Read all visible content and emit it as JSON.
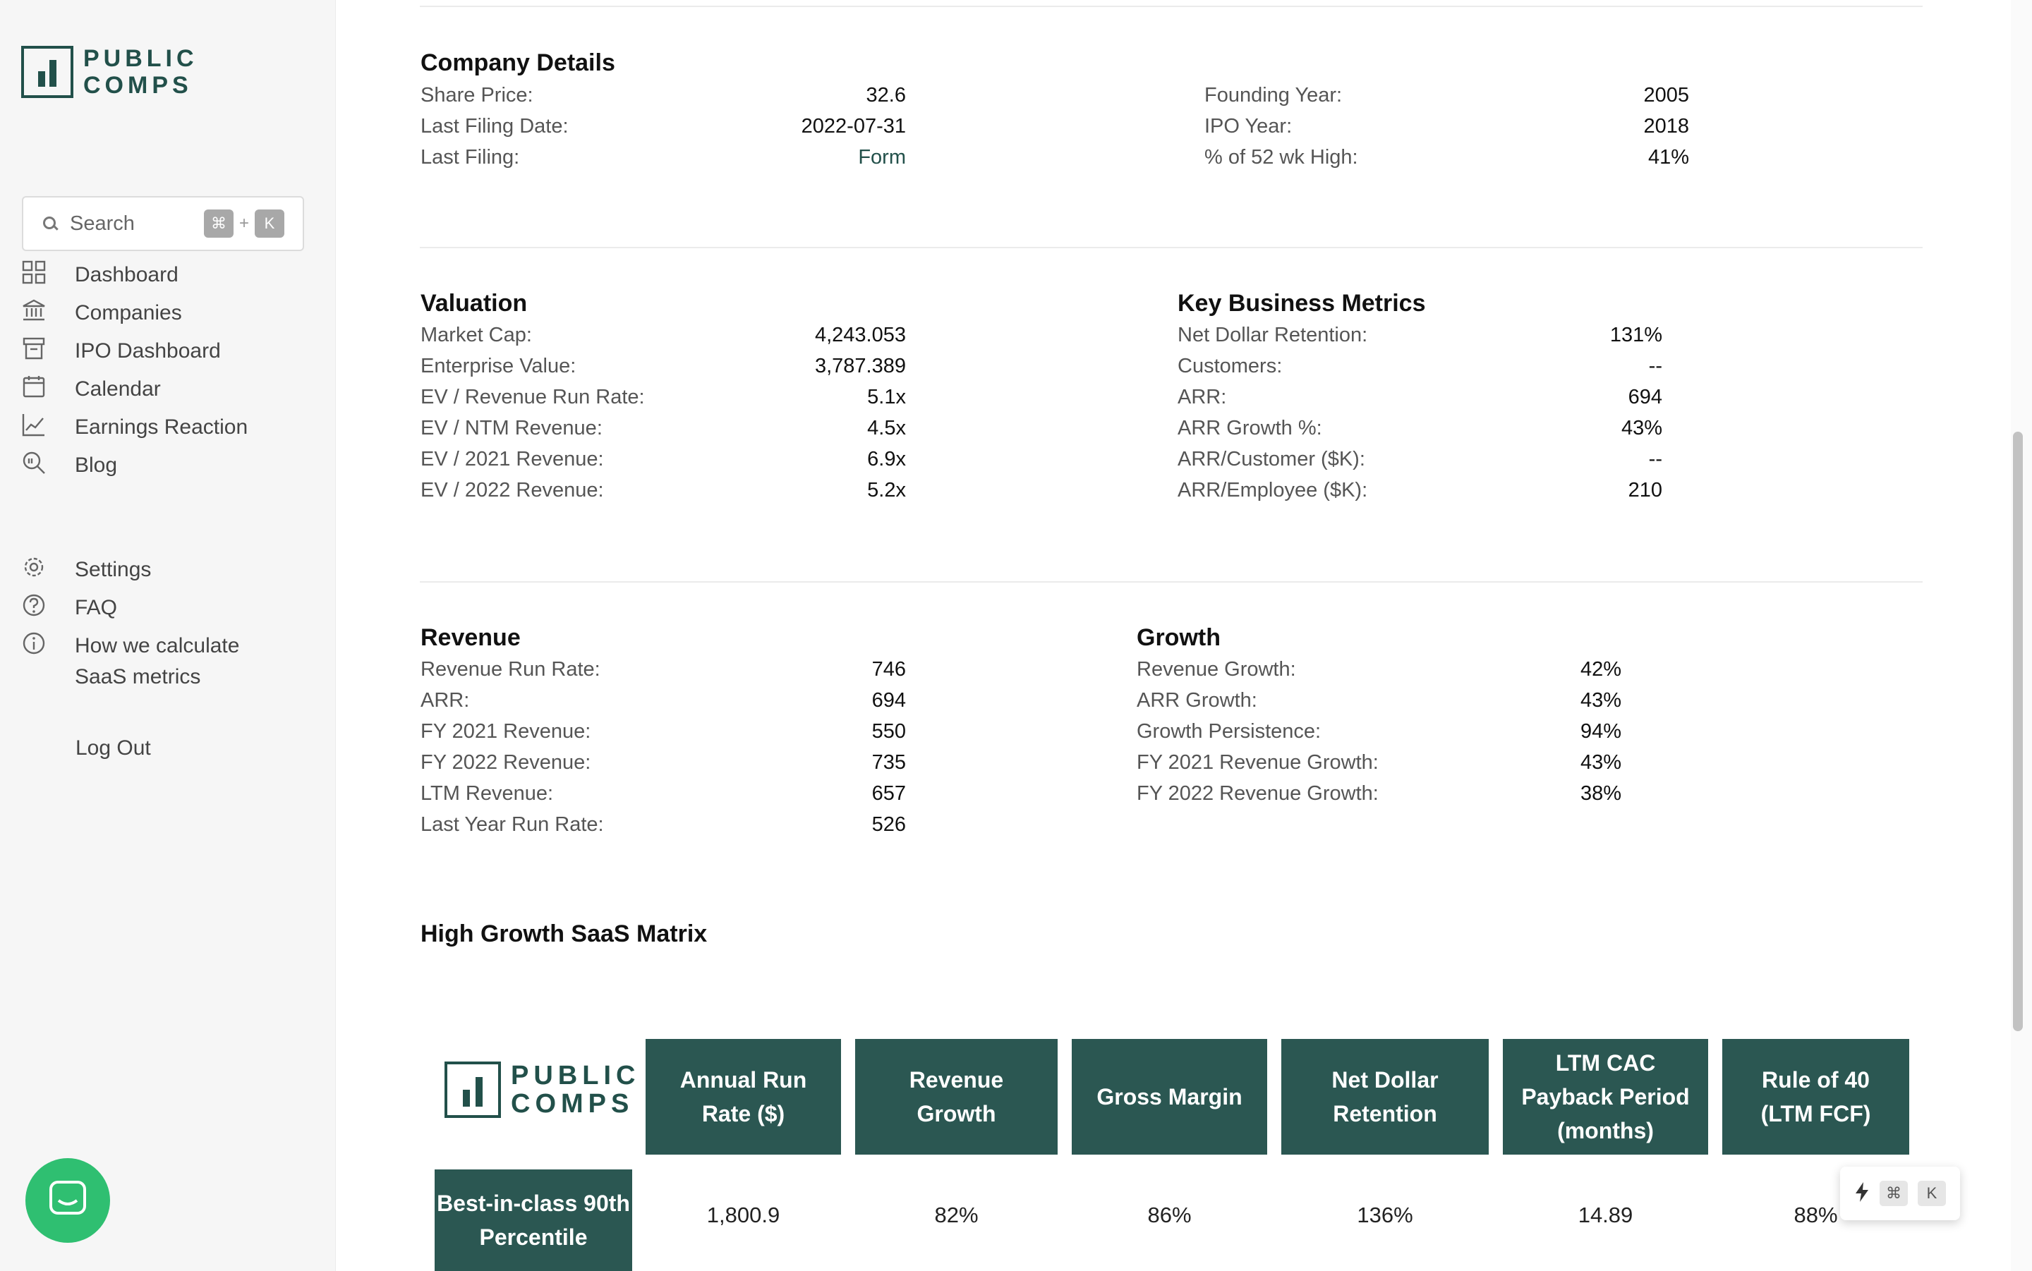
{
  "sidebar": {
    "logo": {
      "line1": "PUBLIC",
      "line2": "COMPS"
    },
    "search": {
      "placeholder": "Search",
      "shortcut_mod": "⌘",
      "shortcut_plus": "+",
      "shortcut_key": "K"
    },
    "nav": [
      {
        "label": "Dashboard",
        "icon": "grid-icon"
      },
      {
        "label": "Companies",
        "icon": "bank-icon"
      },
      {
        "label": "IPO Dashboard",
        "icon": "inbox-icon"
      },
      {
        "label": "Calendar",
        "icon": "calendar-icon"
      },
      {
        "label": "Earnings Reaction",
        "icon": "chart-line-icon"
      },
      {
        "label": "Blog",
        "icon": "search-document-icon"
      }
    ],
    "secondary": [
      {
        "label": "Settings",
        "icon": "gear-icon"
      },
      {
        "label": "FAQ",
        "icon": "question-icon"
      },
      {
        "label": "How we calculate",
        "label2": "SaaS metrics",
        "icon": "info-icon"
      }
    ],
    "logout": "Log Out"
  },
  "company_details": {
    "title": "Company Details",
    "left": [
      {
        "label": "Share Price:",
        "value": "32.6"
      },
      {
        "label": "Last Filing Date:",
        "value": "2022-07-31"
      },
      {
        "label": "Last Filing:",
        "value": "Form"
      }
    ],
    "right": [
      {
        "label": "Founding Year:",
        "value": "2005"
      },
      {
        "label": "IPO Year:",
        "value": "2018"
      },
      {
        "label": "% of 52 wk High:",
        "value": "41%"
      }
    ]
  },
  "valuation": {
    "title": "Valuation",
    "rows": [
      {
        "label": "Market Cap:",
        "value": "4,243.053"
      },
      {
        "label": "Enterprise Value:",
        "value": "3,787.389"
      },
      {
        "label": "EV / Revenue Run Rate:",
        "value": "5.1x"
      },
      {
        "label": "EV / NTM Revenue:",
        "value": "4.5x"
      },
      {
        "label": "EV / 2021 Revenue:",
        "value": "6.9x"
      },
      {
        "label": "EV / 2022 Revenue:",
        "value": "5.2x"
      }
    ]
  },
  "key_metrics": {
    "title": "Key Business Metrics",
    "rows": [
      {
        "label": "Net Dollar Retention:",
        "value": "131%"
      },
      {
        "label": "Customers:",
        "value": "--"
      },
      {
        "label": "ARR:",
        "value": "694"
      },
      {
        "label": "ARR Growth %:",
        "value": "43%"
      },
      {
        "label": "ARR/Customer ($K):",
        "value": "--"
      },
      {
        "label": "ARR/Employee ($K):",
        "value": "210"
      }
    ]
  },
  "revenue": {
    "title": "Revenue",
    "rows": [
      {
        "label": "Revenue Run Rate:",
        "value": "746"
      },
      {
        "label": "ARR:",
        "value": "694"
      },
      {
        "label": "FY 2021 Revenue:",
        "value": "550"
      },
      {
        "label": "FY 2022 Revenue:",
        "value": "735"
      },
      {
        "label": "LTM Revenue:",
        "value": "657"
      },
      {
        "label": "Last Year Run Rate:",
        "value": "526"
      }
    ]
  },
  "growth": {
    "title": "Growth",
    "rows": [
      {
        "label": "Revenue Growth:",
        "value": "42%"
      },
      {
        "label": "ARR Growth:",
        "value": "43%"
      },
      {
        "label": "Growth Persistence:",
        "value": "94%"
      },
      {
        "label": "FY 2021 Revenue Growth:",
        "value": "43%"
      },
      {
        "label": "FY 2022 Revenue Growth:",
        "value": "38%"
      }
    ]
  },
  "matrix": {
    "title": "High Growth SaaS Matrix",
    "logo": {
      "line1": "PUBLIC",
      "line2": "COMPS"
    },
    "headers": [
      "Annual Run Rate ($)",
      "Revenue Growth",
      "Gross Margin",
      "Net Dollar Retention",
      "LTM CAC Payback Period (months)",
      "Rule of 40 (LTM FCF)"
    ],
    "row_label": "Best-in-class 90th Percentile",
    "row_values": [
      "1,800.9",
      "82%",
      "86%",
      "136%",
      "14.89",
      "88%"
    ]
  },
  "shortcut_widget": {
    "icon": "bolt-icon",
    "mod": "⌘",
    "key": "K"
  },
  "colors": {
    "brand": "#22504a",
    "header_fill": "#2b5752",
    "chat": "#2fbf71"
  }
}
